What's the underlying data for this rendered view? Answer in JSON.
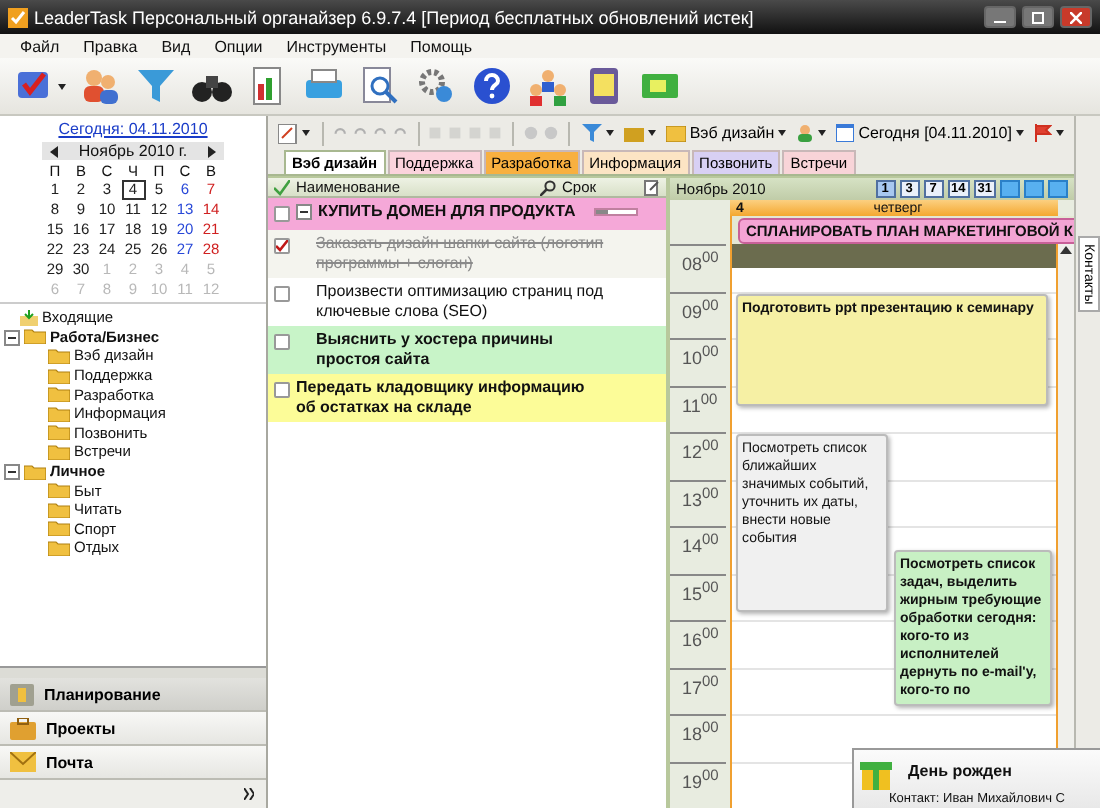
{
  "window": {
    "title": "LeaderTask Персональный органайзер 6.9.7.4 [Период бесплатных обновлений истек]"
  },
  "menu": [
    "Файл",
    "Правка",
    "Вид",
    "Опции",
    "Инструменты",
    "Помощь"
  ],
  "calendar": {
    "today_link": "Сегодня: 04.11.2010",
    "month": "Ноябрь 2010 г.",
    "weekdays": [
      "П",
      "В",
      "С",
      "Ч",
      "П",
      "С",
      "В"
    ],
    "weeks": [
      [
        {
          "label": "1",
          "muted": false,
          "selected": false
        },
        {
          "label": "2",
          "muted": false,
          "selected": false
        },
        {
          "label": "3",
          "muted": false,
          "selected": false
        },
        {
          "label": "4",
          "muted": false,
          "selected": true
        },
        {
          "label": "5",
          "muted": false,
          "selected": false
        },
        {
          "label": "6",
          "muted": false,
          "selected": false
        },
        {
          "label": "7",
          "muted": false,
          "selected": false
        }
      ],
      [
        {
          "label": "8",
          "muted": false,
          "selected": false
        },
        {
          "label": "9",
          "muted": false,
          "selected": false
        },
        {
          "label": "10",
          "muted": false,
          "selected": false
        },
        {
          "label": "11",
          "muted": false,
          "selected": false
        },
        {
          "label": "12",
          "muted": false,
          "selected": false
        },
        {
          "label": "13",
          "muted": false,
          "selected": false
        },
        {
          "label": "14",
          "muted": false,
          "selected": false
        }
      ],
      [
        {
          "label": "15",
          "muted": false,
          "selected": false
        },
        {
          "label": "16",
          "muted": false,
          "selected": false
        },
        {
          "label": "17",
          "muted": false,
          "selected": false
        },
        {
          "label": "18",
          "muted": false,
          "selected": false
        },
        {
          "label": "19",
          "muted": false,
          "selected": false
        },
        {
          "label": "20",
          "muted": false,
          "selected": false
        },
        {
          "label": "21",
          "muted": false,
          "selected": false
        }
      ],
      [
        {
          "label": "22",
          "muted": false,
          "selected": false
        },
        {
          "label": "23",
          "muted": false,
          "selected": false
        },
        {
          "label": "24",
          "muted": false,
          "selected": false
        },
        {
          "label": "25",
          "muted": false,
          "selected": false
        },
        {
          "label": "26",
          "muted": false,
          "selected": false
        },
        {
          "label": "27",
          "muted": false,
          "selected": false
        },
        {
          "label": "28",
          "muted": false,
          "selected": false
        }
      ],
      [
        {
          "label": "29",
          "muted": false,
          "selected": false
        },
        {
          "label": "30",
          "muted": false,
          "selected": false
        },
        {
          "label": "1",
          "muted": true,
          "selected": false
        },
        {
          "label": "2",
          "muted": true,
          "selected": false
        },
        {
          "label": "3",
          "muted": true,
          "selected": false
        },
        {
          "label": "4",
          "muted": true,
          "selected": false
        },
        {
          "label": "5",
          "muted": true,
          "selected": false
        }
      ],
      [
        {
          "label": "6",
          "muted": true,
          "selected": false
        },
        {
          "label": "7",
          "muted": true,
          "selected": false
        },
        {
          "label": "8",
          "muted": true,
          "selected": false
        },
        {
          "label": "9",
          "muted": true,
          "selected": false
        },
        {
          "label": "10",
          "muted": true,
          "selected": false
        },
        {
          "label": "11",
          "muted": true,
          "selected": false
        },
        {
          "label": "12",
          "muted": true,
          "selected": false
        }
      ]
    ]
  },
  "tree": [
    {
      "label": "Входящие",
      "kind": "inbox"
    },
    {
      "label": "Работа/Бизнес",
      "kind": "group",
      "expanded": true,
      "children": [
        {
          "label": "Вэб дизайн"
        },
        {
          "label": "Поддержка"
        },
        {
          "label": "Разработка"
        },
        {
          "label": "Информация"
        },
        {
          "label": "Позвонить"
        },
        {
          "label": "Встречи"
        }
      ]
    },
    {
      "label": "Личное",
      "kind": "group",
      "expanded": true,
      "children": [
        {
          "label": "Быт"
        },
        {
          "label": "Читать"
        },
        {
          "label": "Спорт"
        },
        {
          "label": "Отдых"
        }
      ]
    }
  ],
  "nav": [
    {
      "label": "Планирование",
      "kind": "planning",
      "selected": true
    },
    {
      "label": "Проекты",
      "kind": "projects",
      "selected": false
    },
    {
      "label": "Почта",
      "kind": "mail",
      "selected": false
    }
  ],
  "subtoolbar": {
    "category": "Вэб дизайн",
    "date": "Сегодня [04.11.2010]"
  },
  "tabs": [
    {
      "label": "Вэб дизайн",
      "selected": true,
      "color": "#ffffff"
    },
    {
      "label": "Поддержка",
      "selected": false,
      "color": "#fbd3dc"
    },
    {
      "label": "Разработка",
      "selected": false,
      "color": "#f8b040"
    },
    {
      "label": "Информация",
      "selected": false,
      "color": "#fce4c4"
    },
    {
      "label": "Позвонить",
      "selected": false,
      "color": "#d8d0f4"
    },
    {
      "label": "Встречи",
      "selected": false,
      "color": "#f8d4d8"
    }
  ],
  "task_list": {
    "columns": [
      "Наименование",
      "Срок"
    ],
    "rows": [
      {
        "kind": "group",
        "title": "КУПИТЬ ДОМЕН ДЛЯ ПРОДУКТА",
        "checked": false,
        "expanded": true,
        "bold": true,
        "color": "#f5a8d8",
        "level": 0.3,
        "children": [
          {
            "kind": "task",
            "title": "Заказать дизайн шапки сайта (логотип программы + слоган)",
            "checked": true,
            "bold": false,
            "color": "#f4f4ee"
          },
          {
            "kind": "task",
            "title": "Произвести оптимизацию страниц под ключевые слова (SEO)",
            "checked": false,
            "bold": false,
            "color": "#ffffff"
          },
          {
            "kind": "task",
            "title": "Выяснить у хостера причины простоя сайта",
            "checked": false,
            "bold": true,
            "color": "#c8f4c8"
          }
        ]
      },
      {
        "kind": "task",
        "title": "Передать кладовщику информацию об остатках на складе",
        "checked": false,
        "bold": true,
        "color": "#fcfc98"
      }
    ]
  },
  "day_view": {
    "month": "Ноябрь 2010",
    "spans": [
      {
        "label": "1",
        "selected": true
      },
      {
        "label": "3",
        "selected": false
      },
      {
        "label": "7",
        "selected": false
      },
      {
        "label": "14",
        "selected": false
      },
      {
        "label": "31",
        "selected": false
      }
    ],
    "day_number": "4",
    "weekday": "четверг",
    "all_day": [
      {
        "title": "СПЛАНИРОВАТЬ ПЛАН МАРКЕТИНГОВОЙ К",
        "color": "#f4a4d4"
      }
    ],
    "hours": [
      {
        "label": "08$^{00}$",
        "events": [
          {
            "kind": "busy",
            "color": "#6b6c4e"
          }
        ]
      },
      {
        "label": "09$^{00}$",
        "events": [
          {
            "kind": "wide",
            "title": "Подготовить ppt презентацию к семинару",
            "bold": true,
            "color": "#f6f0a4"
          }
        ]
      },
      {
        "label": "10$^{00}$"
      },
      {
        "label": "11$^{00}$"
      },
      {
        "label": "12$^{00}$",
        "events": [
          {
            "kind": "left",
            "title": "Посмотреть список ближайших значимых событий, уточнить их даты, внести новые события",
            "bold": false,
            "color": "#f0f0f0"
          }
        ]
      },
      {
        "label": "13$^{00}$"
      },
      {
        "label": "14$^{00}$",
        "events": [
          {
            "kind": "right",
            "title": "Посмотреть список задач, выделить жирным требующие обработки сегодня: кого-то из исполнителей дернуть по e-mail'у, кого-то по",
            "bold": true,
            "color": "#c8f0c4"
          }
        ]
      },
      {
        "label": "15$^{00}$"
      },
      {
        "label": "16$^{00}$"
      },
      {
        "label": "17$^{00}$"
      },
      {
        "label": "18$^{00}$"
      },
      {
        "label": "19$^{00}$"
      }
    ]
  },
  "side_tab": "Контакты",
  "reminder": {
    "title": "День рожден",
    "contact": "Контакт: Иван Михайлович С"
  }
}
